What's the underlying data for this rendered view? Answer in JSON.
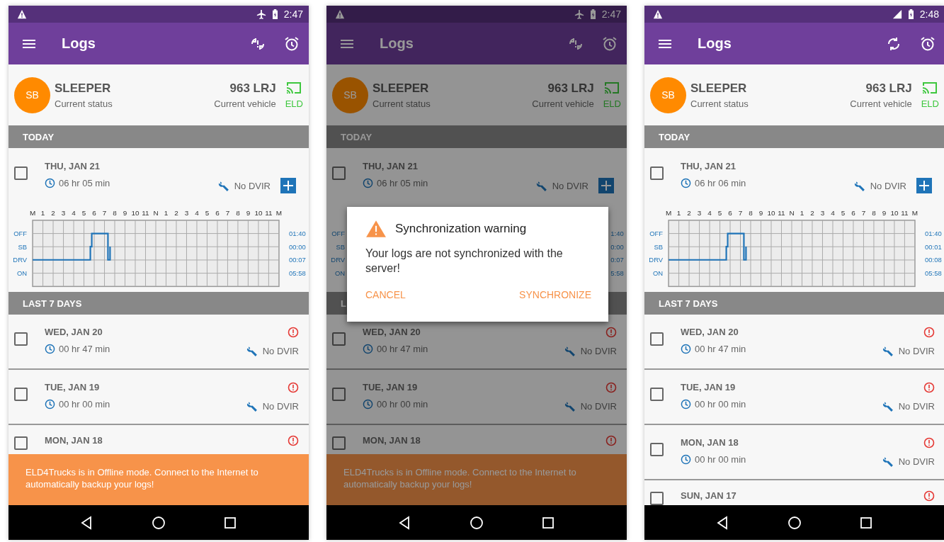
{
  "phones": [
    {
      "status_bar": {
        "time": "2:47",
        "airplane_mode": true
      },
      "app_bar": {
        "title": "Logs",
        "sync_error": true
      },
      "status": {
        "badge": "SB",
        "name": "SLEEPER",
        "caption": "Current status",
        "vehicle": "963 LRJ",
        "vehicle_caption": "Current vehicle",
        "eld": "ELD"
      },
      "today": {
        "header": "TODAY",
        "day": {
          "date": "THU, JAN 21",
          "checked": false,
          "duration": "06 hr 05 min",
          "dvir": "No DVIR"
        },
        "chart": {
          "hours": [
            "M",
            "1",
            "2",
            "3",
            "4",
            "5",
            "6",
            "7",
            "8",
            "9",
            "10",
            "11",
            "N",
            "1",
            "2",
            "3",
            "4",
            "5",
            "6",
            "7",
            "8",
            "9",
            "10",
            "11",
            "M"
          ],
          "rows": [
            {
              "label": "OFF",
              "total": "01:40"
            },
            {
              "label": "SB",
              "total": "00:00"
            },
            {
              "label": "DRV",
              "total": "00:07"
            },
            {
              "label": "ON",
              "total": "05:58"
            }
          ]
        }
      },
      "last7": {
        "header": "LAST 7 DAYS",
        "days": [
          {
            "kind": "full",
            "date": "WED, JAN 20",
            "checked": false,
            "duration": "00 hr 47 min",
            "dvir": "No DVIR"
          },
          {
            "kind": "full",
            "date": "TUE, JAN 19",
            "checked": false,
            "duration": "00 hr 00 min",
            "dvir": "No DVIR"
          },
          {
            "kind": "partial",
            "date": "MON, JAN 18",
            "checked": false
          }
        ]
      },
      "banner": "ELD4Trucks is in Offline mode. Connect to the Internet to automatically backup your logs!"
    },
    {
      "status_bar": {
        "time": "2:47",
        "airplane_mode": true
      },
      "app_bar": {
        "title": "Logs",
        "sync_error": true
      },
      "status": {
        "badge": "SB",
        "name": "SLEEPER",
        "caption": "Current status",
        "vehicle": "963 LRJ",
        "vehicle_caption": "Current vehicle",
        "eld": "ELD"
      },
      "today": {
        "header": "TODAY",
        "day": {
          "date": "THU, JAN 21",
          "checked": false,
          "duration": "06 hr 05 min",
          "dvir": "No DVIR"
        },
        "chart": {
          "rows": [
            {
              "label": "OFF",
              "total": "1:40"
            },
            {
              "label": "SB",
              "total": "0:00"
            },
            {
              "label": "DRV",
              "total": "0:07"
            },
            {
              "label": "ON",
              "total": "5:58"
            }
          ]
        }
      },
      "last7": {
        "header": "L",
        "days": [
          {
            "kind": "full",
            "date": "WED, JAN 20",
            "checked": false,
            "duration": "00 hr 47 min",
            "dvir": "No DVIR"
          },
          {
            "kind": "full",
            "date": "TUE, JAN 19",
            "checked": false,
            "duration": "00 hr 00 min",
            "dvir": "No DVIR"
          },
          {
            "kind": "partial",
            "date": "MON, JAN 18",
            "checked": false
          }
        ]
      },
      "banner": "ELD4Trucks is in Offline mode. Connect to the Internet to automatically backup your logs!",
      "dialog": {
        "title": "Synchronization warning",
        "message": "Your logs are not synchronized with the server!",
        "buttons": [
          "CANCEL",
          "SYNCHRONIZE"
        ]
      }
    },
    {
      "status_bar": {
        "time": "2:48",
        "airplane_mode": false
      },
      "app_bar": {
        "title": "Logs",
        "sync_error": false
      },
      "status": {
        "badge": "SB",
        "name": "SLEEPER",
        "caption": "Current status",
        "vehicle": "963 LRJ",
        "vehicle_caption": "Current vehicle",
        "eld": "ELD"
      },
      "today": {
        "header": "TODAY",
        "day": {
          "date": "THU, JAN 21",
          "checked": false,
          "duration": "06 hr 06 min",
          "dvir": "No DVIR"
        },
        "chart": {
          "hours": [
            "M",
            "1",
            "2",
            "3",
            "4",
            "5",
            "6",
            "7",
            "8",
            "9",
            "10",
            "11",
            "N",
            "1",
            "2",
            "3",
            "4",
            "5",
            "6",
            "7",
            "8",
            "9",
            "10",
            "11",
            "M"
          ],
          "rows": [
            {
              "label": "OFF",
              "total": "01:40"
            },
            {
              "label": "SB",
              "total": "00:01"
            },
            {
              "label": "DRV",
              "total": "00:08"
            },
            {
              "label": "ON",
              "total": "05:58"
            }
          ]
        }
      },
      "last7": {
        "header": "LAST 7 DAYS",
        "days": [
          {
            "kind": "full",
            "date": "WED, JAN 20",
            "checked": false,
            "duration": "00 hr 47 min",
            "dvir": "No DVIR"
          },
          {
            "kind": "full",
            "date": "TUE, JAN 19",
            "checked": false,
            "duration": "00 hr 00 min",
            "dvir": "No DVIR"
          },
          {
            "kind": "full",
            "date": "MON, JAN 18",
            "checked": false,
            "duration": "00 hr 00 min",
            "dvir": "No DVIR"
          },
          {
            "kind": "partial",
            "date": "SUN, JAN 17",
            "checked": false
          }
        ]
      }
    }
  ]
}
